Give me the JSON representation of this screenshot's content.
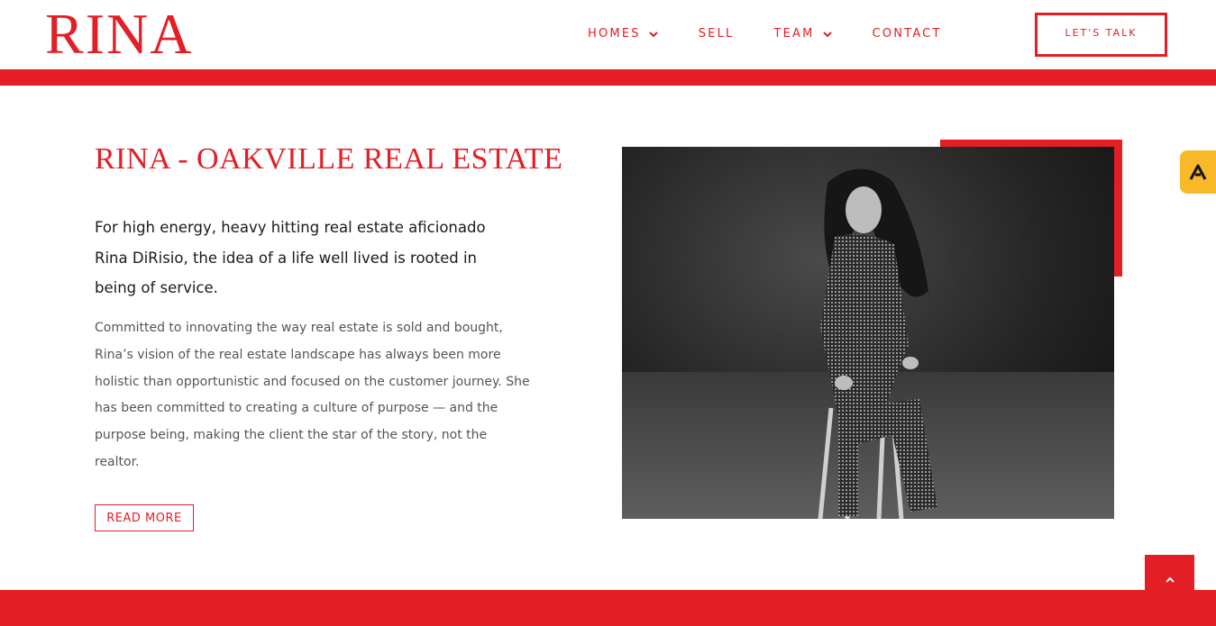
{
  "brand": {
    "logo_text": "RINA",
    "accent_color": "#e31e24"
  },
  "nav": {
    "items": [
      {
        "label": "HOMES",
        "has_dropdown": true
      },
      {
        "label": "SELL",
        "has_dropdown": false
      },
      {
        "label": "TEAM",
        "has_dropdown": true
      },
      {
        "label": "CONTACT",
        "has_dropdown": false
      }
    ],
    "cta_label": "LET'S TALK"
  },
  "main": {
    "title": "RINA - OAKVILLE REAL ESTATE",
    "lead": "For high energy, heavy hitting real estate aficionado Rina DiRisio, the idea of a life well lived is rooted in being of service.",
    "body": "Committed to innovating the way real estate is sold and bought, Rina’s vision of the real estate landscape has always been more holistic than opportunistic and focused on the customer journey. She has been committed to creating a culture of purpose — and the purpose being, making the client the star of the story, not the realtor.",
    "read_more_label": "READ MORE"
  },
  "icons": {
    "side_tab": "brand-a-icon",
    "scroll_top": "chevron-up-icon",
    "dropdown": "chevron-down-icon"
  },
  "side_tab_color": "#f7b928"
}
